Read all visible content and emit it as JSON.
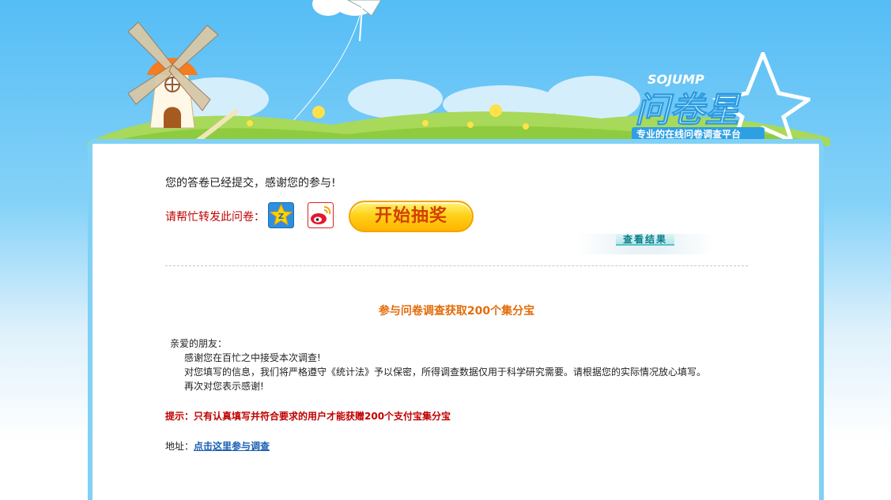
{
  "logo": {
    "brand_en": "SOJUMP",
    "brand_cn": "问卷星",
    "slogan": "专业的在线问卷调查平台"
  },
  "main": {
    "thanks_text": "您的答卷已经提交，感谢您的参与!",
    "share_label": "请帮忙转发此问卷：",
    "share_icons": [
      "qzone-icon",
      "weibo-icon"
    ],
    "lottery_label": "开始抽奖",
    "view_results_label": "查看结果",
    "survey_title": "参与问卷调查获取200个集分宝",
    "letter": {
      "greeting": "亲爱的朋友：",
      "lines": [
        "感谢您在百忙之中接受本次调查!",
        "对您填写的信息，我们将严格遵守《统计法》予以保密，所得调查数据仅用于科学研究需要。请根据您的实际情况放心填写。",
        "再次对您表示感谢!"
      ]
    },
    "tip": "提示：只有认真填写并符合要求的用户才能获赠200个支付宝集分宝",
    "address_label": "地址：",
    "address_link": "点击这里参与调查"
  },
  "colors": {
    "sky": "#55bdf5",
    "card_border": "#7fd1f5",
    "accent_red": "#c00000",
    "accent_orange": "#e36c09",
    "link_blue": "#1a5fb4"
  }
}
